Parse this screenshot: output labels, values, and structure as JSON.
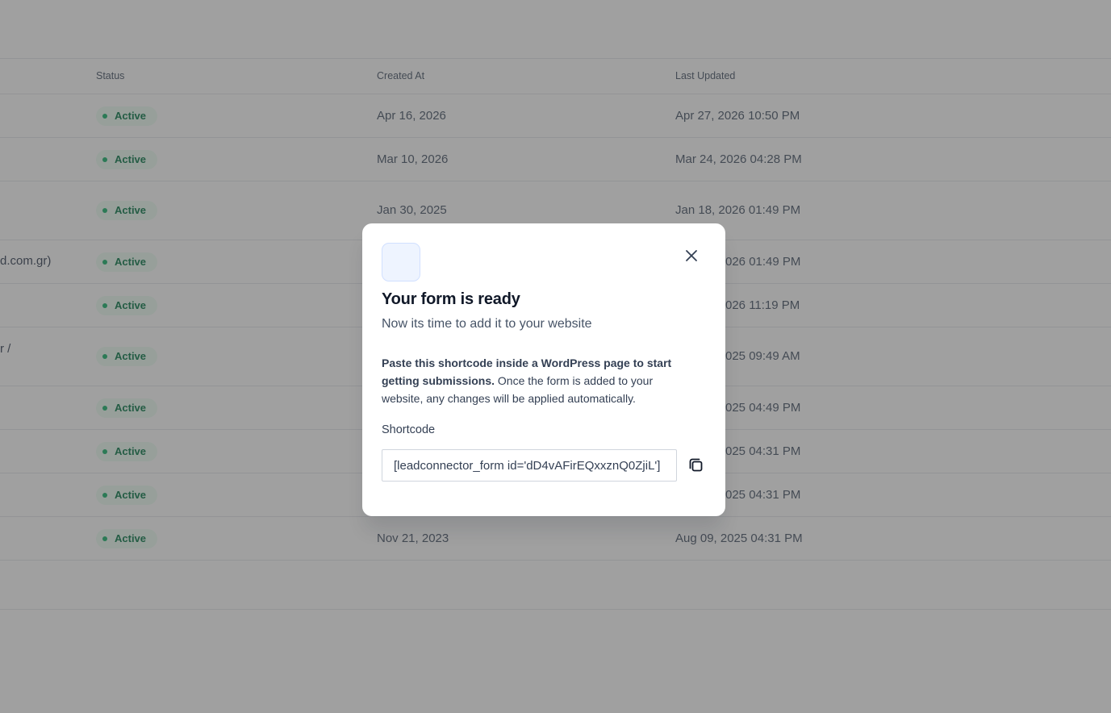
{
  "table": {
    "headers": {
      "status": "Status",
      "created_at": "Created At",
      "last_updated": "Last Updated"
    },
    "rows": [
      {
        "name": "",
        "status": "Active",
        "created_at": "Apr 16, 2026",
        "last_updated": "Apr 27, 2026 10:50 PM"
      },
      {
        "name": "",
        "status": "Active",
        "created_at": "Mar 10, 2026",
        "last_updated": "Mar 24, 2026 04:28 PM"
      },
      {
        "name": "",
        "status": "Active",
        "created_at": "Jan 30, 2025",
        "last_updated": "Jan 18, 2026 01:49 PM"
      },
      {
        "name": "d.com.gr)",
        "status": "Active",
        "created_at": "",
        "last_updated": "026 01:49 PM"
      },
      {
        "name": "",
        "status": "Active",
        "created_at": "",
        "last_updated": "026 11:19 PM"
      },
      {
        "name": "r /",
        "status": "Active",
        "created_at": "",
        "last_updated": "025 09:49 AM"
      },
      {
        "name": "",
        "status": "Active",
        "created_at": "",
        "last_updated": "025 04:49 PM"
      },
      {
        "name": "",
        "status": "Active",
        "created_at": "",
        "last_updated": "025 04:31 PM"
      },
      {
        "name": "",
        "status": "Active",
        "created_at": "",
        "last_updated": "025 04:31 PM"
      },
      {
        "name": "",
        "status": "Active",
        "created_at": "Nov 21, 2023",
        "last_updated": "Aug 09, 2025 04:31 PM"
      }
    ]
  },
  "modal": {
    "title": "Your form is ready",
    "subtitle": "Now its time to add it to your website",
    "desc_bold": "Paste this shortcode inside a WordPress page to start getting submissions.",
    "desc_rest": " Once the form is added to your website, any changes will be applied automatically.",
    "field_label": "Shortcode",
    "shortcode_value": "[leadconnector_form id='dD4vAFirEQxxznQ0ZjiL']",
    "close_icon": "close-icon",
    "copy_icon": "copy-icon"
  },
  "colors": {
    "badge_bg": "#ecfdf3",
    "badge_text": "#067647",
    "badge_dot": "#17b26a",
    "overlay": "rgba(66,66,66,0.5)",
    "modal_icon_bg": "#eef4ff"
  }
}
